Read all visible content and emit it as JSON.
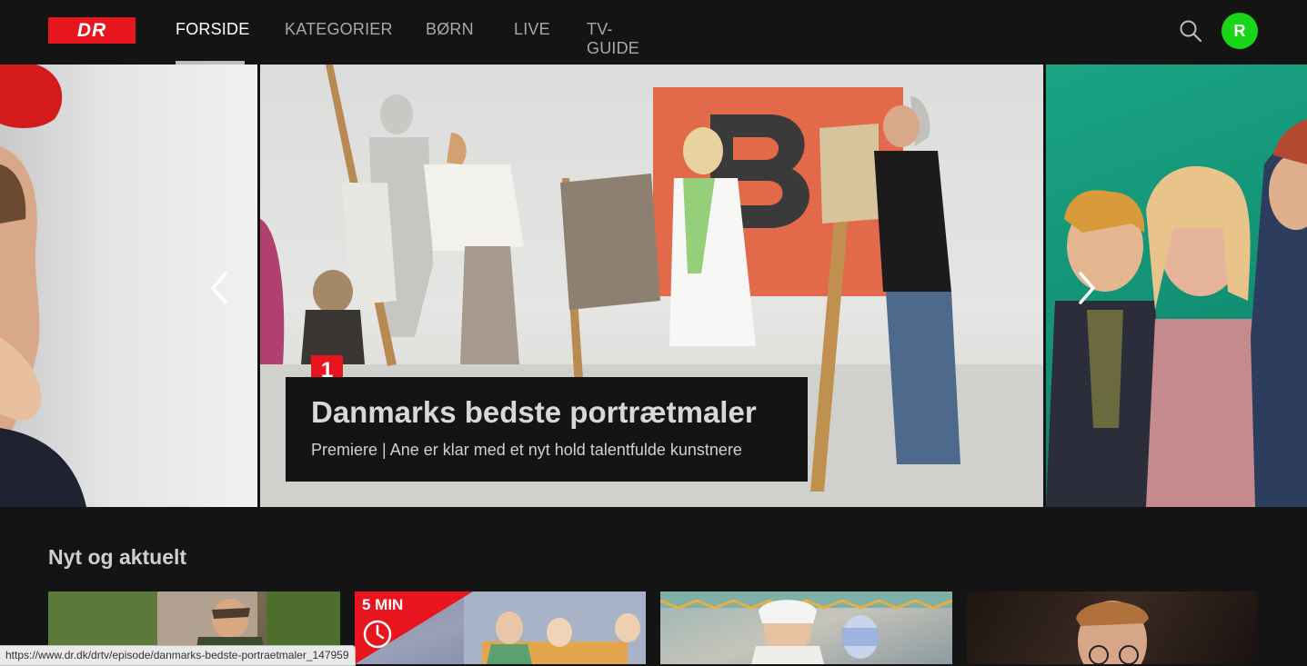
{
  "brand": {
    "logo_text": "DR",
    "logo_color": "#e8141e"
  },
  "nav": {
    "items": [
      {
        "label": "FORSIDE",
        "active": true
      },
      {
        "label": "KATEGORIER",
        "active": false
      },
      {
        "label": "BØRN",
        "active": false
      },
      {
        "label": "LIVE",
        "active": false
      },
      {
        "label": "TV-GUIDE",
        "active": false
      }
    ]
  },
  "header": {
    "search_icon": "search-icon",
    "avatar_initial": "R",
    "avatar_color": "#19d619"
  },
  "hero": {
    "rank": "1",
    "title": "Danmarks bedste portrætmaler",
    "subtitle": "Premiere | Ane er klar med et nyt hold talentfulde kunstnere",
    "prev_icon": "chevron-left-icon",
    "next_icon": "chevron-right-icon"
  },
  "section": {
    "title": "Nyt og aktuelt",
    "tiles": [
      {
        "badge": ""
      },
      {
        "badge": "5 MIN",
        "badge_icon": "clock-icon"
      },
      {
        "badge": ""
      },
      {
        "badge": ""
      }
    ]
  },
  "status_bar": {
    "url": "https://www.dr.dk/drtv/episode/danmarks-bedste-portraetmaler_147959"
  }
}
